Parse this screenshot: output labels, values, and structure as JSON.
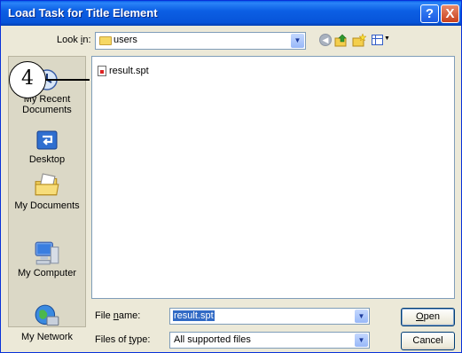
{
  "window": {
    "title": "Load Task for Title Element",
    "help_button": "?",
    "close_button": "X"
  },
  "look_in": {
    "label_pre": "Look ",
    "label_key": "i",
    "label_post": "n:",
    "value": "users"
  },
  "toolbar": {
    "back_icon": "back-arrow-icon",
    "up_icon": "up-folder-icon",
    "new_folder_icon": "new-folder-icon",
    "views_icon": "views-menu-icon"
  },
  "places": [
    {
      "line1": "My Recent",
      "line2": "Documents",
      "icon": "recent-documents-icon"
    },
    {
      "line1": "Desktop",
      "line2": "",
      "icon": "desktop-icon"
    },
    {
      "line1": "My Documents",
      "line2": "",
      "icon": "my-documents-icon"
    },
    {
      "line1": "My Computer",
      "line2": "",
      "icon": "my-computer-icon"
    },
    {
      "line1": "My Network",
      "line2": "",
      "icon": "my-network-icon"
    }
  ],
  "files": [
    {
      "name": "result.spt"
    }
  ],
  "file_name": {
    "label_pre": "File ",
    "label_key": "n",
    "label_post": "ame:",
    "value": "result.spt"
  },
  "file_type": {
    "label_pre": "Files of ",
    "label_key": "t",
    "label_post": "ype:",
    "value": "All supported files"
  },
  "buttons": {
    "open_key": "O",
    "open_rest": "pen",
    "cancel": "Cancel"
  },
  "callout": {
    "number": "4"
  }
}
